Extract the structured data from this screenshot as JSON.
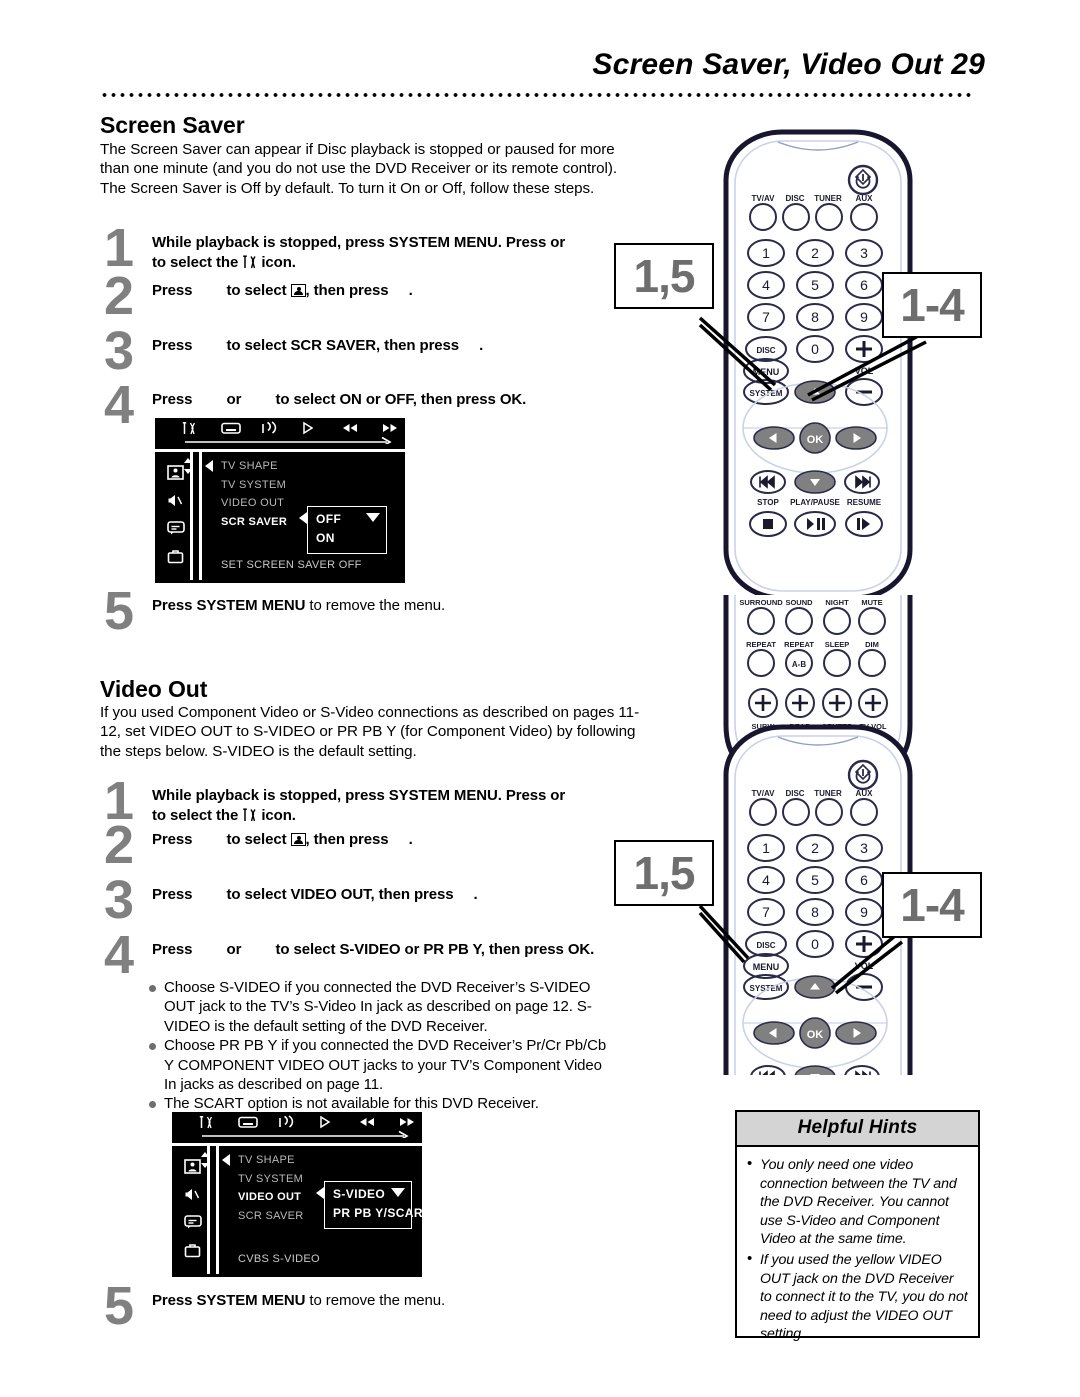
{
  "header": {
    "title": "Screen Saver, Video Out  29"
  },
  "screen_saver": {
    "heading": "Screen Saver",
    "intro": "The Screen Saver can appear if Disc playback is stopped or paused for more than one minute (and you do not use the DVD Receiver or its remote control). The Screen Saver is Off by default. To turn it On or Off, follow these steps.",
    "steps": [
      {
        "num": "1",
        "text_a": "While playback is stopped, press ",
        "bold_a": "SYSTEM MENU",
        "text_b": ". Press or ",
        "text_c": " to select the ",
        "icon": "tools-icon",
        "text_d": " icon."
      },
      {
        "num": "2",
        "text_a": "Press ",
        "text_b": " to select ",
        "icon": "picture-settings-icon",
        "text_c": ", then press ",
        "text_d": "."
      },
      {
        "num": "3",
        "text_a": "Press ",
        "text_b": " to select ",
        "bold_a": "SCR SAVER",
        "text_c": ", then press ",
        "text_d": "."
      },
      {
        "num": "4",
        "text_a": "Press ",
        "text_b": " or ",
        "text_c": " to select ",
        "bold_a": "ON",
        "text_d": " or ",
        "bold_b": "OFF",
        "text_e": ", then press ",
        "bold_c": "OK",
        "text_f": "."
      },
      {
        "num": "5",
        "text_a": "Press ",
        "bold_a": "SYSTEM MENU",
        "text_b": " to remove the menu",
        "text_c": "."
      }
    ],
    "osd": {
      "menu_items": [
        "TV SHAPE",
        "TV SYSTEM",
        "VIDEO OUT",
        "SCR SAVER"
      ],
      "selected_item": "SCR SAVER",
      "popup_options": [
        "OFF",
        "ON"
      ],
      "status": "SET SCREEN SAVER OFF",
      "top_icons": [
        "tools-icon",
        "display-icon",
        "audio-icon",
        "play-icon",
        "prev-icon",
        "next-icon",
        "screen-icon"
      ],
      "side_icons": [
        "picture-settings-icon",
        "speaker-icon",
        "subtitle-icon",
        "preferences-icon"
      ]
    }
  },
  "video_out": {
    "heading": "Video Out",
    "intro": "If you used Component Video or S-Video connections as described on pages 11-12, set VIDEO OUT to S-VIDEO or PR PB Y (for Component Video) by following the steps below. S-VIDEO is the default setting.",
    "steps": [
      {
        "num": "1",
        "text_a": "While playback is stopped, press ",
        "bold_a": "SYSTEM MENU",
        "text_b": ". Press or ",
        "text_c": " to select the ",
        "icon": "tools-icon",
        "text_d": " icon."
      },
      {
        "num": "2",
        "text_a": "Press ",
        "text_b": " to select ",
        "icon": "picture-settings-icon",
        "text_c": ", then press ",
        "text_d": "."
      },
      {
        "num": "3",
        "text_a": "Press ",
        "text_b": " to select ",
        "bold_a": "VIDEO OUT",
        "text_c": ", then press ",
        "text_d": "."
      },
      {
        "num": "4",
        "text_a": "Press ",
        "text_b": " or ",
        "text_c": " to select ",
        "bold_a": "S-VIDEO",
        "text_d": " or ",
        "bold_b": "PR PB Y",
        "text_e": ", then press ",
        "bold_c": "OK",
        "text_f": "."
      },
      {
        "num": "5",
        "text_a": "Press ",
        "bold_a": "SYSTEM MENU",
        "text_b": " to remove the menu",
        "text_c": "."
      }
    ],
    "bullets": [
      "Choose S-VIDEO if you connected the DVD Receiver’s S-VIDEO OUT jack to the TV’s S-Video In jack as described on page 12. S-VIDEO is the default setting of the DVD Receiver.",
      "Choose PR PB Y if you connected the DVD Receiver’s Pr/Cr Pb/Cb Y COMPONENT VIDEO OUT jacks to your TV’s Component Video In jacks as described on page 11.",
      "The SCART option is not available for this DVD Receiver."
    ],
    "osd": {
      "menu_items": [
        "TV SHAPE",
        "TV SYSTEM",
        "VIDEO OUT",
        "SCR SAVER"
      ],
      "selected_item": "VIDEO OUT",
      "popup_options": [
        "S-VIDEO",
        "PR PB Y/SCART"
      ],
      "status": "CVBS S-VIDEO",
      "top_icons": [
        "tools-icon",
        "display-icon",
        "audio-icon",
        "play-icon",
        "prev-icon",
        "next-icon",
        "screen-icon"
      ],
      "side_icons": [
        "picture-settings-icon",
        "speaker-icon",
        "subtitle-icon",
        "preferences-icon"
      ]
    }
  },
  "callouts": {
    "steps_1_5": "1,5",
    "steps_1_4": "1-4"
  },
  "remote": {
    "power_icon": "power-icon",
    "source_buttons": [
      "TV/AV",
      "DISC",
      "TUNER",
      "AUX"
    ],
    "numeric_buttons": [
      "1",
      "2",
      "3",
      "4",
      "5",
      "6",
      "7",
      "8",
      "9",
      "0"
    ],
    "disc_menu_label_1": "DISC",
    "disc_menu_label_2": "MENU",
    "system_label": "SYSTEM",
    "vol_label": "VOL",
    "vol_plus": "+",
    "vol_minus": "–",
    "ok_label": "OK",
    "transport_labels": [
      "STOP",
      "PLAY/PAUSE",
      "RESUME"
    ],
    "sound_buttons": [
      "SURROUND",
      "SOUND",
      "NIGHT",
      "MUTE"
    ],
    "repeat_buttons": [
      "REPEAT",
      "REPEAT",
      "SLEEP",
      "DIM"
    ],
    "repeat_ab_label": "A-B",
    "level_buttons": [
      "SUBW",
      "REAR",
      "CENTER",
      "TV VOL"
    ]
  },
  "hints": {
    "title": "Helpful Hints",
    "items": [
      "You only need one video connection between the TV and the DVD Receiver. You cannot use S-Video and Component Video at the same time.",
      "If you used the yellow VIDEO OUT jack on the DVD Receiver to connect it to the TV, you do not need to adjust the VIDEO OUT setting."
    ]
  },
  "colors": {
    "step_number": "#808080",
    "hints_header_bg": "#d4d4d4",
    "osd_bg": "#000000",
    "remote_button_fill": "#808080"
  }
}
